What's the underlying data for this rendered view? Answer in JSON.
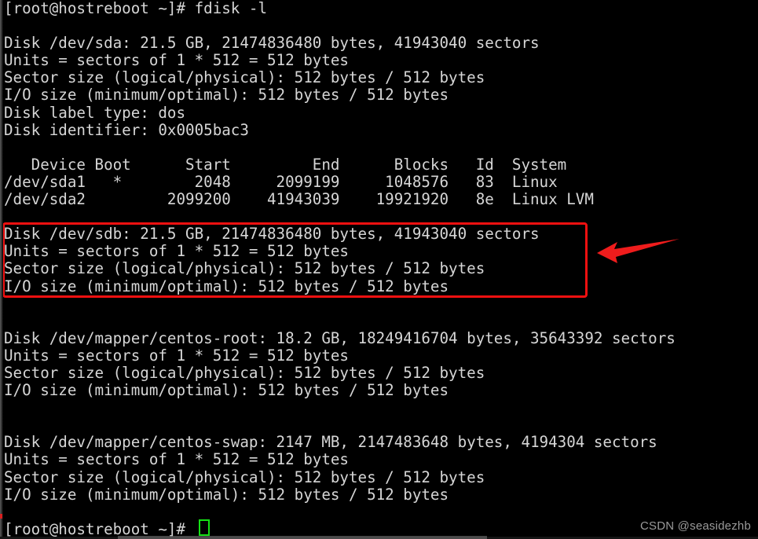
{
  "terminal": {
    "prompt_top": "[root@hostreboot ~]# fdisk -l",
    "prompt_bottom": "[root@hostreboot ~]# ",
    "cursor": "block-cursor",
    "colors": {
      "background": "#000000",
      "foreground": "#d6d6d6",
      "cursor": "#15e015",
      "annotation": "#f01010",
      "watermark": "#9a9a9a"
    },
    "lines": [
      "[root@hostreboot ~]# fdisk -l",
      "",
      "Disk /dev/sda: 21.5 GB, 21474836480 bytes, 41943040 sectors",
      "Units = sectors of 1 * 512 = 512 bytes",
      "Sector size (logical/physical): 512 bytes / 512 bytes",
      "I/O size (minimum/optimal): 512 bytes / 512 bytes",
      "Disk label type: dos",
      "Disk identifier: 0x0005bac3",
      "",
      "   Device Boot      Start         End      Blocks   Id  System",
      "/dev/sda1   *        2048     2099199     1048576   83  Linux",
      "/dev/sda2         2099200    41943039    19921920   8e  Linux LVM",
      "",
      "Disk /dev/sdb: 21.5 GB, 21474836480 bytes, 41943040 sectors",
      "Units = sectors of 1 * 512 = 512 bytes",
      "Sector size (logical/physical): 512 bytes / 512 bytes",
      "I/O size (minimum/optimal): 512 bytes / 512 bytes",
      "",
      "",
      "Disk /dev/mapper/centos-root: 18.2 GB, 18249416704 bytes, 35643392 sectors",
      "Units = sectors of 1 * 512 = 512 bytes",
      "Sector size (logical/physical): 512 bytes / 512 bytes",
      "I/O size (minimum/optimal): 512 bytes / 512 bytes",
      "",
      "",
      "Disk /dev/mapper/centos-swap: 2147 MB, 2147483648 bytes, 4194304 sectors",
      "Units = sectors of 1 * 512 = 512 bytes",
      "Sector size (logical/physical): 512 bytes / 512 bytes",
      "I/O size (minimum/optimal): 512 bytes / 512 bytes",
      "",
      "[root@hostreboot ~]# "
    ]
  },
  "disks": [
    {
      "device": "/dev/sda",
      "size_human": "21.5 GB",
      "size_bytes": "21474836480",
      "sectors": "41943040",
      "units": "sectors of 1 * 512 = 512 bytes",
      "sector_size": "512 bytes / 512 bytes",
      "io_size": "512 bytes / 512 bytes",
      "label_type": "dos",
      "identifier": "0x0005bac3",
      "partition_table": {
        "headers": [
          "Device",
          "Boot",
          "Start",
          "End",
          "Blocks",
          "Id",
          "System"
        ],
        "rows": [
          [
            "/dev/sda1",
            "*",
            "2048",
            "2099199",
            "1048576",
            "83",
            "Linux"
          ],
          [
            "/dev/sda2",
            "",
            "2099200",
            "41943039",
            "19921920",
            "8e",
            "Linux LVM"
          ]
        ]
      }
    },
    {
      "device": "/dev/sdb",
      "size_human": "21.5 GB",
      "size_bytes": "21474836480",
      "sectors": "41943040",
      "units": "sectors of 1 * 512 = 512 bytes",
      "sector_size": "512 bytes / 512 bytes",
      "io_size": "512 bytes / 512 bytes",
      "highlighted": true
    },
    {
      "device": "/dev/mapper/centos-root",
      "size_human": "18.2 GB",
      "size_bytes": "18249416704",
      "sectors": "35643392",
      "units": "sectors of 1 * 512 = 512 bytes",
      "sector_size": "512 bytes / 512 bytes",
      "io_size": "512 bytes / 512 bytes"
    },
    {
      "device": "/dev/mapper/centos-swap",
      "size_human": "2147 MB",
      "size_bytes": "2147483648",
      "sectors": "4194304",
      "units": "sectors of 1 * 512 = 512 bytes",
      "sector_size": "512 bytes / 512 bytes",
      "io_size": "512 bytes / 512 bytes"
    }
  ],
  "annotations": {
    "box_label": "highlight-dev-sdb",
    "arrow_label": "pointer-to-dev-sdb"
  },
  "watermark": {
    "text": "CSDN @seasidezhb"
  }
}
